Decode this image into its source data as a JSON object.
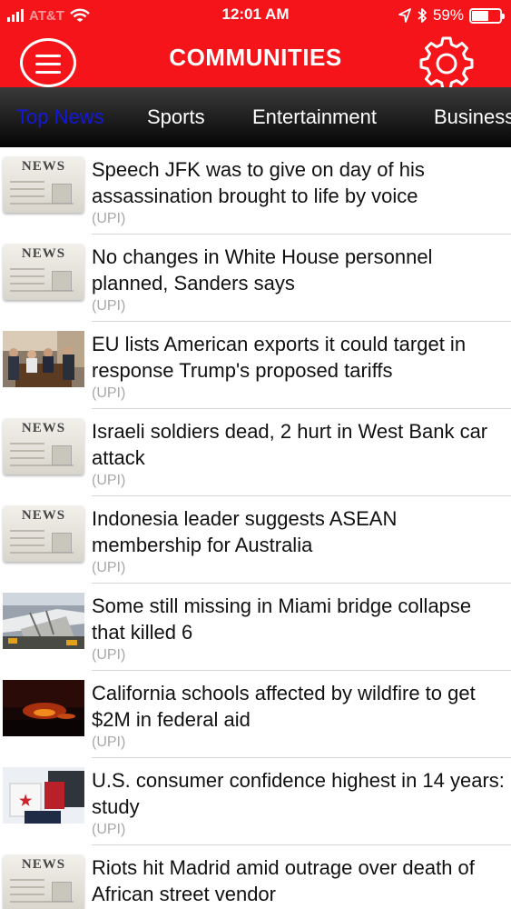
{
  "status_bar": {
    "carrier": "AT&T",
    "time": "12:01 AM",
    "battery_percent": 59,
    "battery_label": "59%",
    "icons": [
      "signal-icon",
      "wifi-icon",
      "location-arrow-icon",
      "bluetooth-icon",
      "battery-icon"
    ]
  },
  "header": {
    "title": "COMMUNITIES",
    "menu_icon": "hamburger-menu-icon",
    "settings_icon": "gear-icon",
    "color": "#f5141a"
  },
  "tabs": [
    {
      "label": "Top News",
      "active": true
    },
    {
      "label": "Sports",
      "active": false
    },
    {
      "label": "Entertainment",
      "active": false
    },
    {
      "label": "Business",
      "active": false
    }
  ],
  "articles": [
    {
      "headline": "Speech JFK was to give on day of his assassination brought to life by voice",
      "source": "(UPI)",
      "thumbnail": "news-placeholder",
      "thumb_text": "NEWS"
    },
    {
      "headline": "No changes in White House personnel planned, Sanders says",
      "source": "(UPI)",
      "thumbnail": "news-placeholder",
      "thumb_text": "NEWS"
    },
    {
      "headline": "EU lists American exports it could target in response Trump's proposed tariffs",
      "source": "(UPI)",
      "thumbnail": "photo-signing-ceremony"
    },
    {
      "headline": "Israeli soldiers dead, 2 hurt in West Bank car attack",
      "source": "(UPI)",
      "thumbnail": "news-placeholder",
      "thumb_text": "NEWS"
    },
    {
      "headline": "Indonesia leader suggests ASEAN membership for Australia",
      "source": "(UPI)",
      "thumbnail": "news-placeholder",
      "thumb_text": "NEWS"
    },
    {
      "headline": "Some still missing in Miami bridge collapse that killed 6",
      "source": "(UPI)",
      "thumbnail": "photo-bridge-collapse"
    },
    {
      "headline": "California schools affected by wildfire to get $2M in federal aid",
      "source": "(UPI)",
      "thumbnail": "photo-wildfire-night"
    },
    {
      "headline": "U.S. consumer confidence highest in 14 years: study",
      "source": "(UPI)",
      "thumbnail": "photo-shopping-bags"
    },
    {
      "headline": "Riots hit Madrid amid outrage over death of African street vendor",
      "source": "",
      "thumbnail": "news-placeholder",
      "thumb_text": "NEWS"
    }
  ]
}
